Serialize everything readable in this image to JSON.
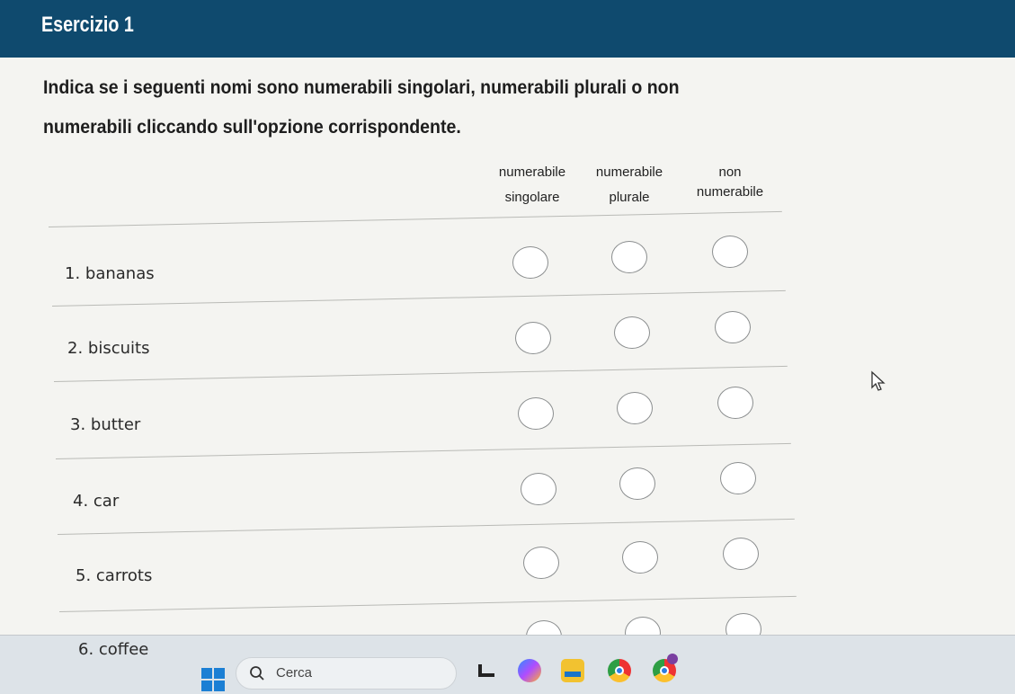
{
  "header": {
    "title": "Esercizio 1"
  },
  "instructions": "Indica se i seguenti nomi sono numerabili singolari, numerabili plurali o non numerabili cliccando sull'opzione corrispondente.",
  "columns": [
    {
      "line1": "numerabile",
      "line2": "singolare"
    },
    {
      "line1": "numerabile",
      "line2": "plurale"
    },
    {
      "line1": "non",
      "line2": "numerabile"
    }
  ],
  "rows": [
    {
      "label": "1. bananas"
    },
    {
      "label": "2. biscuits"
    },
    {
      "label": "3. butter"
    },
    {
      "label": "4. car"
    },
    {
      "label": "5. carrots"
    },
    {
      "label": "6. coffee"
    }
  ],
  "taskbar": {
    "search_placeholder": "Cerca",
    "icons": [
      "windows-start-icon",
      "search-icon",
      "file-explorer-icon",
      "copilot-icon",
      "folder-icon",
      "chrome-icon",
      "chrome-profile-icon"
    ]
  },
  "colors": {
    "header_bg": "#0f4a6e",
    "page_bg": "#f4f4f1",
    "radio_border": "#8b8e8f"
  }
}
